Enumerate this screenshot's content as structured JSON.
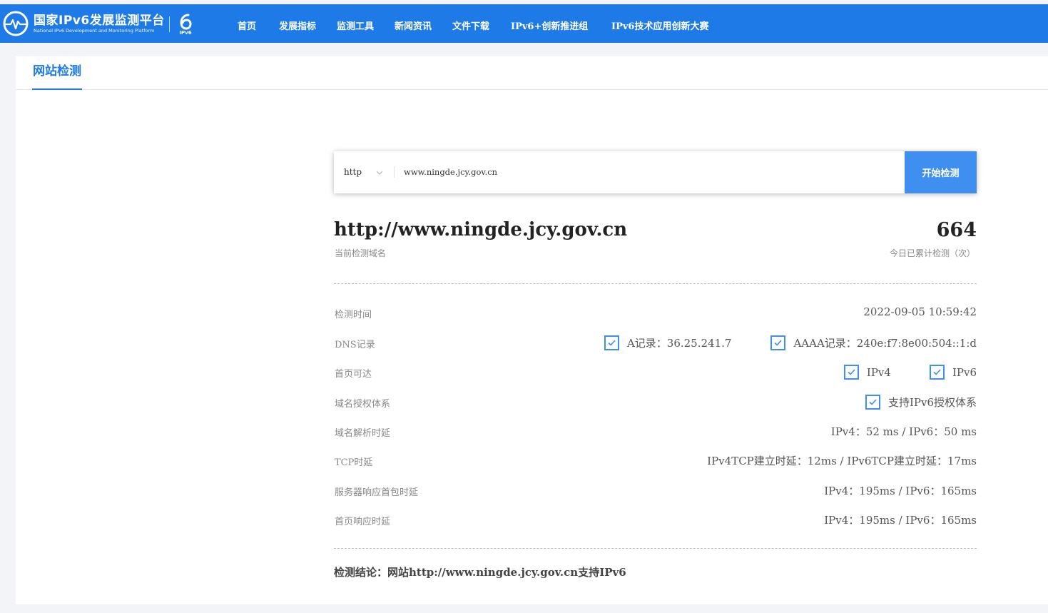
{
  "header": {
    "logo_title": "国家IPv6发展监测平台",
    "logo_subtitle": "National IPv6 Development and Monitoring Platform",
    "badge_text": "IPv6",
    "nav": [
      "首页",
      "发展指标",
      "监测工具",
      "新闻资讯",
      "文件下载",
      "IPv6+创新推进组",
      "IPv6技术应用创新大赛"
    ]
  },
  "tabs": {
    "active": "网站检测"
  },
  "search": {
    "protocol": "http",
    "url_value": "www.ningde.jcy.gov.cn",
    "button_label": "开始检测"
  },
  "summary": {
    "domain": "http://www.ningde.jcy.gov.cn",
    "domain_caption": "当前检测域名",
    "count": "664",
    "count_caption": "今日已累计检测（次）"
  },
  "results": {
    "time_label": "检测时间",
    "time_value": "2022-09-05 10:59:42",
    "dns_label": "DNS记录",
    "dns_a": "A记录：36.25.241.7",
    "dns_aaaa": "AAAA记录：240e:f7:8e00:504::1:d",
    "reach_label": "首页可达",
    "reach_v4": "IPv4",
    "reach_v6": "IPv6",
    "auth_label": "域名授权体系",
    "auth_value": "支持IPv6授权体系",
    "resolve_label": "域名解析时延",
    "resolve_value": "IPv4：52 ms / IPv6：50 ms",
    "tcp_label": "TCP时延",
    "tcp_value": "IPv4TCP建立时延：12ms / IPv6TCP建立时延：17ms",
    "first_packet_label": "服务器响应首包时延",
    "first_packet_value": "IPv4：195ms / IPv6：165ms",
    "page_label": "首页响应时延",
    "page_value": "IPv4：195ms / IPv6：165ms"
  },
  "conclusion": "检测结论：网站http://www.ningde.jcy.gov.cn支持IPv6",
  "colors": {
    "brand": "#1d7ae6",
    "button": "#3f8ff0",
    "check": "#3f8ff0"
  }
}
